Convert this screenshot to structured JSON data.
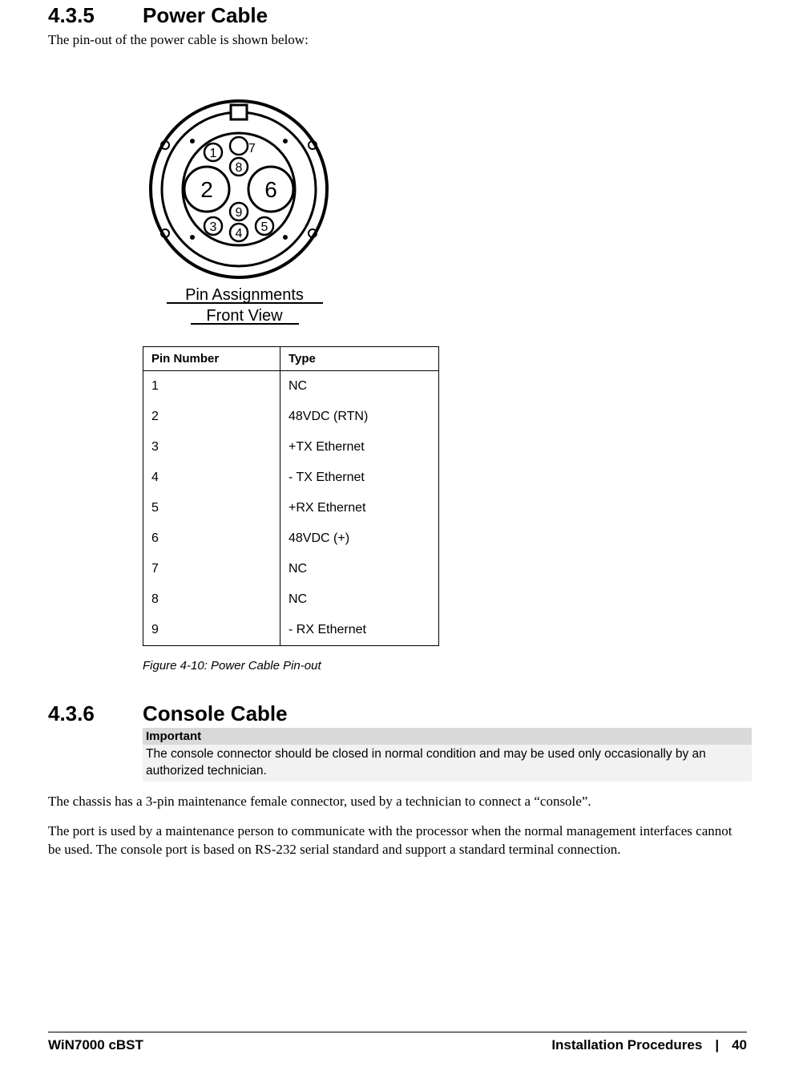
{
  "section_435": {
    "number": "4.3.5",
    "title": "Power Cable",
    "intro": "The pin-out of the power cable is shown below:",
    "diagram_label_line1": "Pin  Assignments",
    "diagram_label_line2": "Front  View",
    "pin_labels": {
      "p1": "1",
      "p2": "2",
      "p3": "3",
      "p4": "4",
      "p5": "5",
      "p6": "6",
      "p7": "7",
      "p8": "8",
      "p9": "9"
    }
  },
  "pin_table": {
    "head_col1": "Pin Number",
    "head_col2": "Type",
    "rows": [
      {
        "pin": "1",
        "type": "NC"
      },
      {
        "pin": "2",
        "type": "48VDC (RTN)"
      },
      {
        "pin": "3",
        "type": "+TX Ethernet"
      },
      {
        "pin": "4",
        "type": "- TX Ethernet"
      },
      {
        "pin": "5",
        "type": "+RX Ethernet"
      },
      {
        "pin": "6",
        "type": "48VDC (+)"
      },
      {
        "pin": "7",
        "type": "NC"
      },
      {
        "pin": "8",
        "type": "NC"
      },
      {
        "pin": "9",
        "type": "- RX Ethernet"
      }
    ]
  },
  "figure_caption": "Figure 4-10: Power Cable Pin-out",
  "section_436": {
    "number": "4.3.6",
    "title": "Console Cable",
    "note_head": "Important",
    "note_body": "The console connector should be closed in normal condition and may be used only occasionally by an authorized technician.",
    "para1": "The chassis has a 3-pin maintenance female connector, used by a technician to connect a “console”.",
    "para2": "The port is used by a maintenance person to communicate with the processor when the normal management interfaces cannot be used. The console port is based on RS-232 serial standard and support a standard terminal connection."
  },
  "footer": {
    "left": "WiN7000 cBST",
    "chapter": "Installation Procedures",
    "sep": "|",
    "page": "40"
  }
}
